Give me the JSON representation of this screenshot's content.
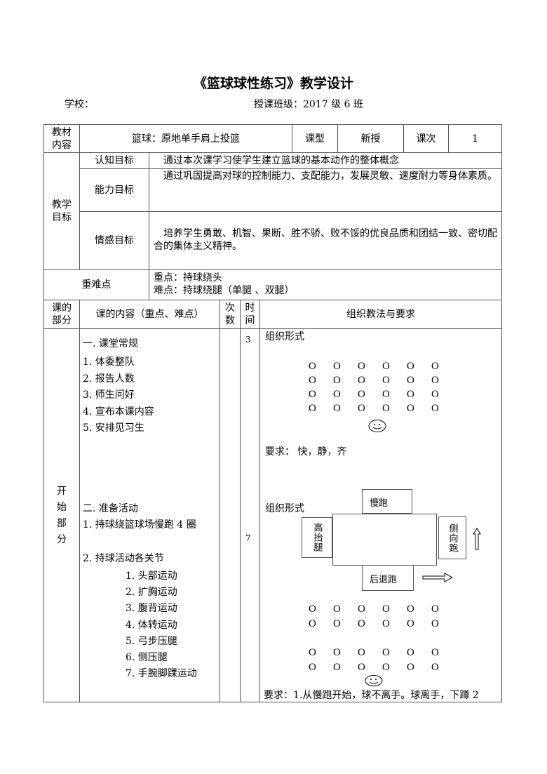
{
  "header": {
    "title": "《篮球球性练习》教学设计",
    "school_label": "学校：",
    "class_label": "授课班级：2017 级 6 班"
  },
  "row1": {
    "label": "教材内容",
    "content": "篮球：原地单手肩上投篮",
    "type_label": "课型",
    "type_value": "新授",
    "lesson_label": "课次",
    "lesson_value": "1"
  },
  "goals": {
    "label": "教学目标",
    "items": [
      {
        "name": "认知目标",
        "text": "通过本次课学习使学生建立篮球的基本动作的整体概念"
      },
      {
        "name": "能力目标",
        "text": "通过巩固提高对球的控制能力、支配能力，发展灵敏、速度耐力等身体素质。"
      },
      {
        "name": "情感目标",
        "text": "培养学生勇敢、机智、果断、胜不骄、败不馁的优良品质和团结一致、密切配合的集体主义精神。"
      }
    ]
  },
  "key_points": {
    "label": "重难点",
    "focus": "重点：持球绕头",
    "difficulty": "难点：持球绕腿（单腿 、双腿）"
  },
  "lesson_header": {
    "part": "课的部分",
    "content": "课的内容（重点、难点）",
    "count": "次数",
    "time": "时间",
    "org": "组织教法与要求"
  },
  "start_part": {
    "label": "开始部分",
    "section1": {
      "title": "一. 课堂常规",
      "items": [
        "1. 体委整队",
        "2. 报告人数",
        "3. 师生问好",
        "4. 宣布本课内容",
        "5. 安排见习生"
      ],
      "time": "3",
      "org_title": "组织形式",
      "formation_rows": 4,
      "formation_cols": 6,
      "student_symbol": "O",
      "requirement": "要求：  快，静，齐"
    },
    "section2": {
      "title": "二. 准备活动",
      "item1": "1. 持球绕篮球场慢跑 4 圈",
      "item2": "2. 持球活动各关节",
      "subitems": [
        "1. 头部运动",
        "2. 扩胸运动",
        "3. 腹背运动",
        "4. 体转运动",
        "5. 弓步压腿",
        "6. 侧压腿",
        "7. 手腕脚踝运动"
      ],
      "time": "7",
      "org_title": "组织形式",
      "court": {
        "top": "慢跑",
        "left": "高抬腿",
        "right": "侧向跑",
        "bottom": "后退跑"
      },
      "formation_rows": 4,
      "formation_cols": 6,
      "student_symbol": "O",
      "requirement": "要求：1.从慢跑开始，球不离手。球离手，下蹲 2"
    }
  }
}
